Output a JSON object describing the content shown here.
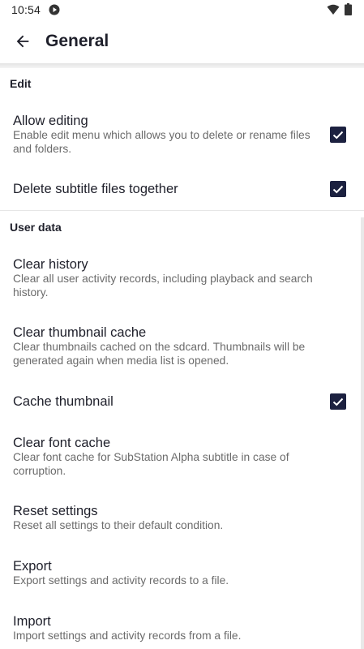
{
  "status_bar": {
    "time": "10:54",
    "icons": [
      "play-circle-icon",
      "wifi-icon",
      "battery-icon"
    ]
  },
  "toolbar": {
    "back_icon": "arrow-back-icon",
    "title": "General"
  },
  "sections": {
    "edit": {
      "header": "Edit",
      "allow_editing": {
        "title": "Allow editing",
        "summary": "Enable edit menu which allows you to delete or rename files and folders.",
        "checked": true
      },
      "delete_subtitle": {
        "title": "Delete subtitle files together",
        "checked": true
      }
    },
    "user_data": {
      "header": "User data",
      "clear_history": {
        "title": "Clear history",
        "summary": "Clear all user activity records, including playback and search history."
      },
      "clear_thumbnail_cache": {
        "title": "Clear thumbnail cache",
        "summary": "Clear thumbnails cached on the sdcard. Thumbnails will be generated again when media list is opened."
      },
      "cache_thumbnail": {
        "title": "Cache thumbnail",
        "checked": true
      },
      "clear_font_cache": {
        "title": "Clear font cache",
        "summary": "Clear font cache for SubStation Alpha subtitle in case of corruption."
      },
      "reset_settings": {
        "title": "Reset settings",
        "summary": "Reset all settings to their default condition."
      },
      "export": {
        "title": "Export",
        "summary": "Export settings and activity records to a file."
      },
      "import": {
        "title": "Import",
        "summary": "Import settings and activity records from a file."
      }
    }
  },
  "colors": {
    "accent": "#1c2140",
    "title_text": "#1e1f2a",
    "summary_text": "#6b6b6b"
  }
}
